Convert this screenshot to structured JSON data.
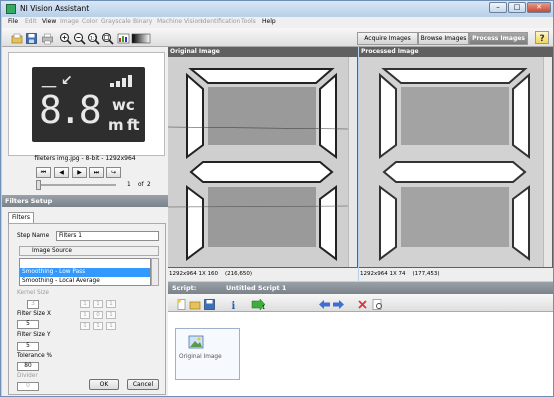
{
  "window": {
    "title": "NI Vision Assistant"
  },
  "menu": [
    "File",
    "Edit",
    "View",
    "Image",
    "Color",
    "Grayscale",
    "Binary",
    "Machine Vision",
    "Identification",
    "Tools",
    "Help"
  ],
  "menu_enabled": [
    true,
    false,
    true,
    false,
    false,
    false,
    false,
    false,
    false,
    false,
    true
  ],
  "tabs": {
    "acquire": "Acquire Images",
    "browse": "Browse Images",
    "process": "Process Images"
  },
  "thumbnail": {
    "glyphs_top": "⸏ ↙",
    "digits": "8.8",
    "unit_right_1": "wc",
    "unit_right_2": "m ft",
    "caption": "fileters img.jpg - 8-bit - 1292x964"
  },
  "image_nav": {
    "current": "1",
    "of_label": "of",
    "total": "2"
  },
  "filters_setup": {
    "header": "Filters Setup",
    "tab": "Filters",
    "step_name_label": "Step Name",
    "step_name_value": "Filters 1",
    "image_source_label": "Image Source",
    "list_items": [
      "Smoothing - Low Pass",
      "Smoothing - Local Average"
    ],
    "selected_index": 0,
    "kernel_size_label": "Kernel Size",
    "kernel_size_value": "3",
    "kernel": [
      "1",
      "1",
      "1",
      "1",
      "0",
      "1",
      "1",
      "1",
      "1"
    ],
    "filter_x_label": "Filter Size X",
    "filter_x_value": "5",
    "filter_y_label": "Filter Size Y",
    "filter_y_value": "5",
    "tolerance_label": "Tolerance %",
    "tolerance_value": "80",
    "divider_label": "Divider",
    "divider_value": "0",
    "ok": "OK",
    "cancel": "Cancel"
  },
  "viewers": {
    "original": {
      "title": "Original Image",
      "status": "1292x964 1X 160    (216,650)"
    },
    "processed": {
      "title": "Processed Image",
      "status": "1292x964 1X 74    (177,453)"
    }
  },
  "script": {
    "label": "Script:",
    "name": "Untitled Script 1",
    "step_label": "Original Image"
  },
  "colors": {
    "accent": "#3399ff",
    "panel_header": "#7a828a",
    "active_tab": "#8c8c8c"
  }
}
